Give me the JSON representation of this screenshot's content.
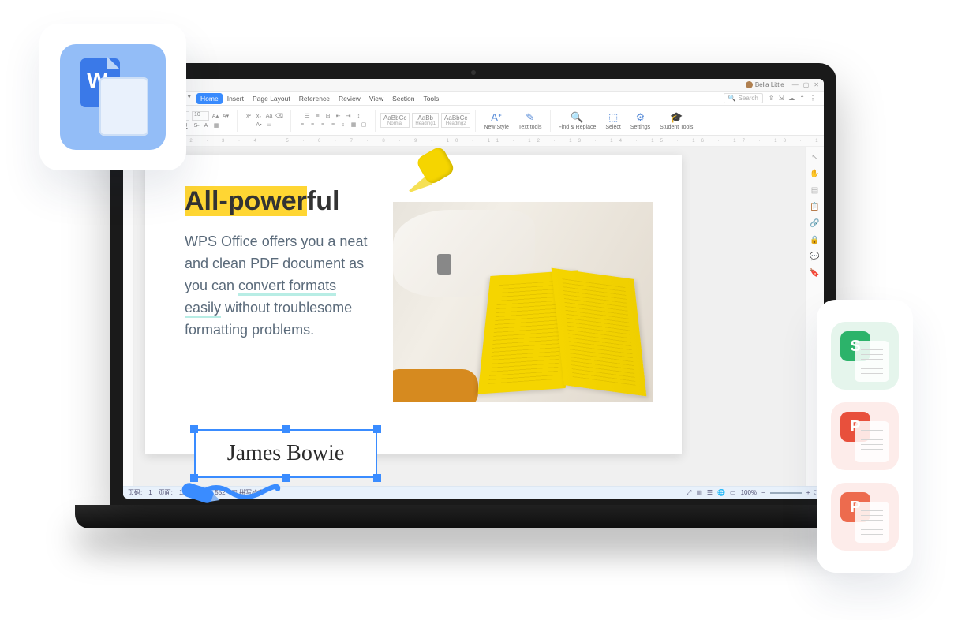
{
  "titlebar": {
    "tab_close": "×",
    "tab_add": "+",
    "user_name": "Bella Little"
  },
  "menubar": {
    "items": [
      "Home",
      "Insert",
      "Page Layout",
      "Reference",
      "Review",
      "View",
      "Section",
      "Tools"
    ],
    "active_index": 0,
    "search_placeholder": "Search"
  },
  "ribbon": {
    "font_size": "10",
    "styles": [
      {
        "sample": "AaBbCc",
        "name": "Normal"
      },
      {
        "sample": "AaBb",
        "name": "Heading1"
      },
      {
        "sample": "AaBbCc",
        "name": "Heading2"
      }
    ],
    "actions": {
      "new_style": "New Style",
      "text_tools": "Text tools",
      "find_replace": "Find & Replace",
      "select": "Select",
      "settings": "Settings",
      "student_tools": "Student Tools"
    }
  },
  "document": {
    "headline_highlight": "All-power",
    "headline_tail": "ful",
    "body_before": "WPS Office offers you a neat and clean PDF document as you can ",
    "body_highlight": "convert formats easily",
    "body_after": " without troublesome formatting problems.",
    "signature": "James Bowie"
  },
  "statusbar": {
    "page_label": "页码:",
    "page_value": "1",
    "pages_label": "页面:",
    "pages_value": "1/5",
    "words_label": "字数:",
    "words_value": "552",
    "spellcheck": "拼写检查",
    "zoom": "100%"
  },
  "floaters": {
    "writer": "W",
    "sheets": "S",
    "pdf": "P",
    "presentation": "P"
  }
}
